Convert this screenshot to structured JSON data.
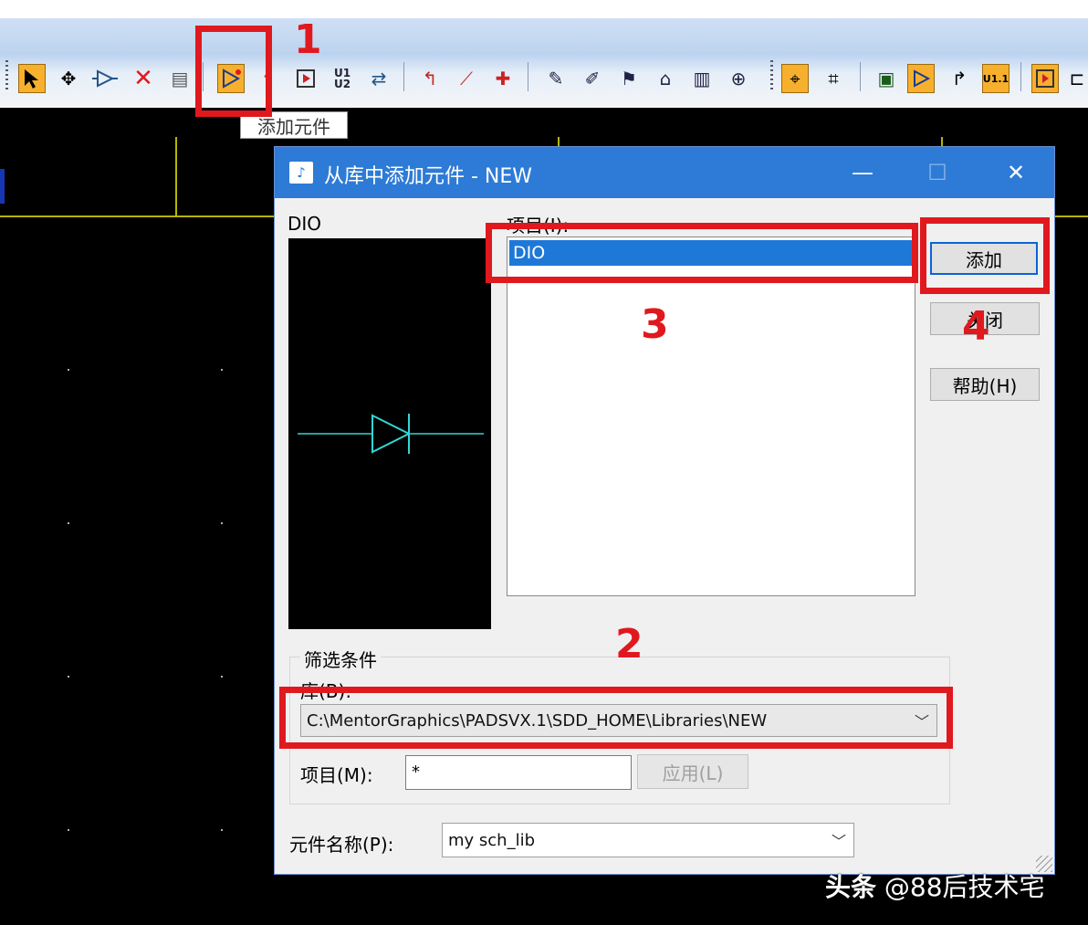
{
  "toolbar": {
    "tooltip": "添加元件"
  },
  "dialog": {
    "title": "从库中添加元件 - NEW",
    "preview_label": "DIO",
    "items_label": "项目(I):",
    "items": [
      {
        "label": "DIO",
        "selected": true
      }
    ],
    "buttons": {
      "add": "添加",
      "close": "关闭",
      "help": "帮助(H)",
      "apply": "应用(L)"
    },
    "filter": {
      "group_label": "筛选条件",
      "library_label": "库(B):",
      "library_value": "C:\\MentorGraphics\\PADSVX.1\\SDD_HOME\\Libraries\\NEW",
      "item_label": "项目(M):",
      "item_value": "*"
    },
    "part_name_label": "元件名称(P):",
    "part_name_value": "my sch_lib"
  },
  "annotations": {
    "step1": "1",
    "step2": "2",
    "step3": "3",
    "step4": "4"
  },
  "watermark": {
    "bold_part": "头条",
    "rest": "@88后技术宅"
  },
  "colors": {
    "annotation_red": "#e0191e",
    "titlebar_blue": "#2d7bd6",
    "selection_blue": "#1e78d8",
    "schematic_yellow": "#b7b400",
    "diode_cyan": "#33d6d6"
  }
}
